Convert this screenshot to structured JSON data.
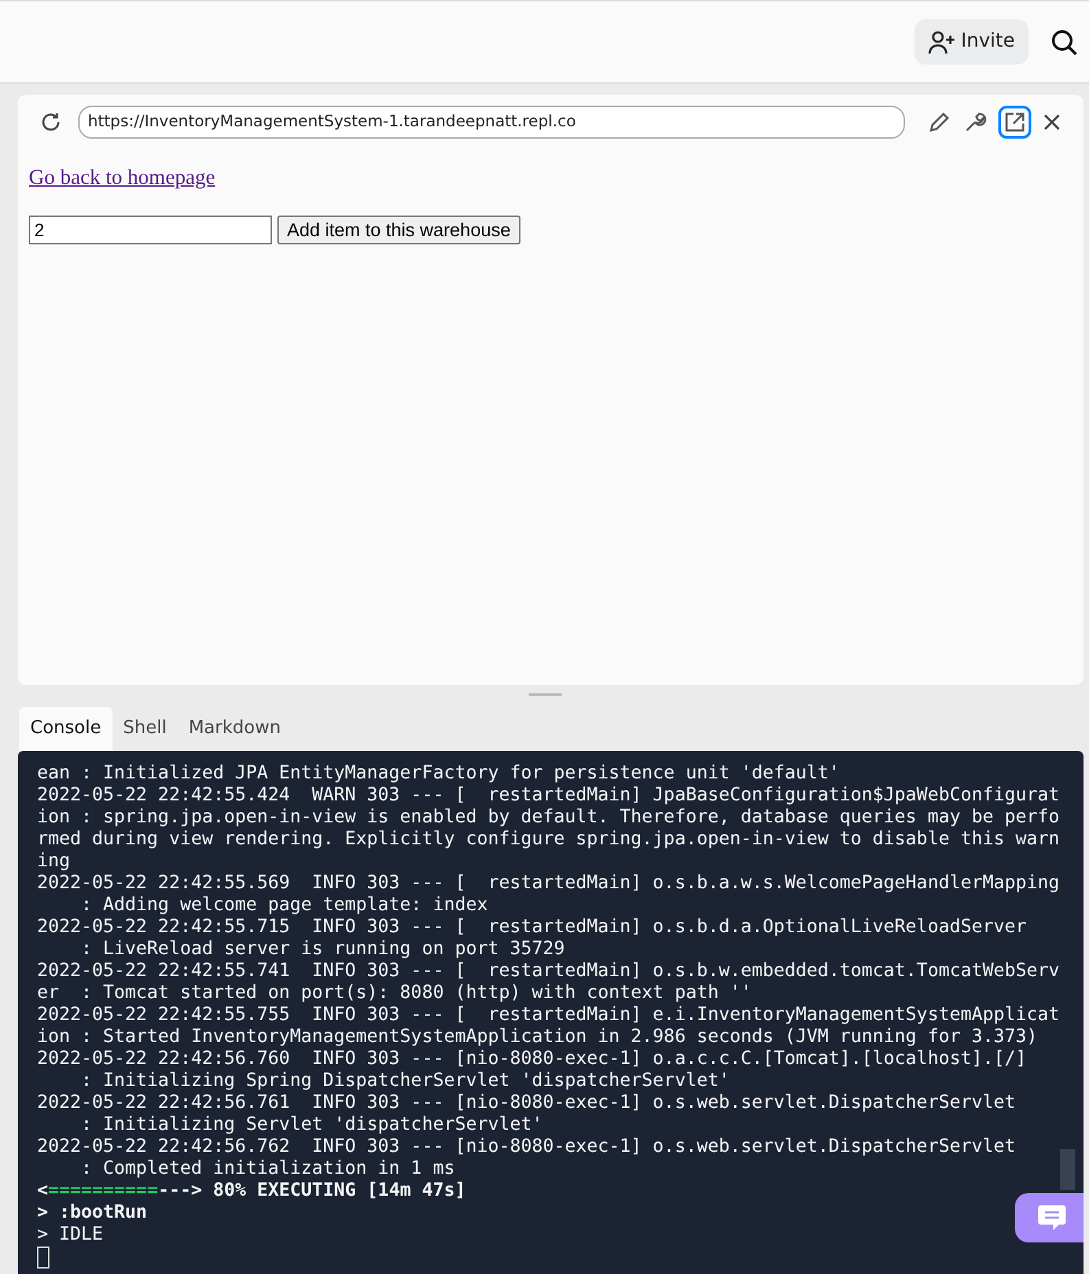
{
  "header": {
    "invite": "Invite"
  },
  "webview": {
    "url": "https://InventoryManagementSystem-1.tarandeepnatt.repl.co",
    "link": "Go back to homepage",
    "quantity": "2",
    "add_button": "Add item to this warehouse"
  },
  "tabs": [
    {
      "label": "Console",
      "selected": true
    },
    {
      "label": "Shell",
      "selected": false
    },
    {
      "label": "Markdown",
      "selected": false
    }
  ],
  "console": [
    {
      "kind": "log",
      "text": "ean : Initialized JPA EntityManagerFactory for persistence unit 'default'"
    },
    {
      "kind": "log",
      "text": "2022-05-22 22:42:55.424  WARN 303 --- [  restartedMain] JpaBaseConfiguration$JpaWebConfigurat"
    },
    {
      "kind": "log",
      "text": "ion : spring.jpa.open-in-view is enabled by default. Therefore, database queries may be perfo"
    },
    {
      "kind": "log",
      "text": "rmed during view rendering. Explicitly configure spring.jpa.open-in-view to disable this warn"
    },
    {
      "kind": "log",
      "text": "ing"
    },
    {
      "kind": "log",
      "text": "2022-05-22 22:42:55.569  INFO 303 --- [  restartedMain] o.s.b.a.w.s.WelcomePageHandlerMapping"
    },
    {
      "kind": "log",
      "text": "    : Adding welcome page template: index"
    },
    {
      "kind": "log",
      "text": "2022-05-22 22:42:55.715  INFO 303 --- [  restartedMain] o.s.b.d.a.OptionalLiveReloadServer"
    },
    {
      "kind": "log",
      "text": "    : LiveReload server is running on port 35729"
    },
    {
      "kind": "log",
      "text": "2022-05-22 22:42:55.741  INFO 303 --- [  restartedMain] o.s.b.w.embedded.tomcat.TomcatWebServ"
    },
    {
      "kind": "log",
      "text": "er  : Tomcat started on port(s): 8080 (http) with context path ''"
    },
    {
      "kind": "log",
      "text": "2022-05-22 22:42:55.755  INFO 303 --- [  restartedMain] e.i.InventoryManagementSystemApplicat"
    },
    {
      "kind": "log",
      "text": "ion : Started InventoryManagementSystemApplication in 2.986 seconds (JVM running for 3.373)"
    },
    {
      "kind": "log",
      "text": "2022-05-22 22:42:56.760  INFO 303 --- [nio-8080-exec-1] o.a.c.c.C.[Tomcat].[localhost].[/]"
    },
    {
      "kind": "log",
      "text": "    : Initializing Spring DispatcherServlet 'dispatcherServlet'"
    },
    {
      "kind": "log",
      "text": "2022-05-22 22:42:56.761  INFO 303 --- [nio-8080-exec-1] o.s.web.servlet.DispatcherServlet"
    },
    {
      "kind": "log",
      "text": "    : Initializing Servlet 'dispatcherServlet'"
    },
    {
      "kind": "log",
      "text": "2022-05-22 22:42:56.762  INFO 303 --- [nio-8080-exec-1] o.s.web.servlet.DispatcherServlet"
    },
    {
      "kind": "log",
      "text": "    : Completed initialization in 1 ms"
    },
    {
      "kind": "progress",
      "open": "<",
      "done": "==========",
      "rest": "---> 80% EXECUTING [14m 47s]"
    },
    {
      "kind": "bold",
      "text": "> :bootRun"
    },
    {
      "kind": "log",
      "text": "> IDLE"
    },
    {
      "kind": "cursor"
    }
  ]
}
